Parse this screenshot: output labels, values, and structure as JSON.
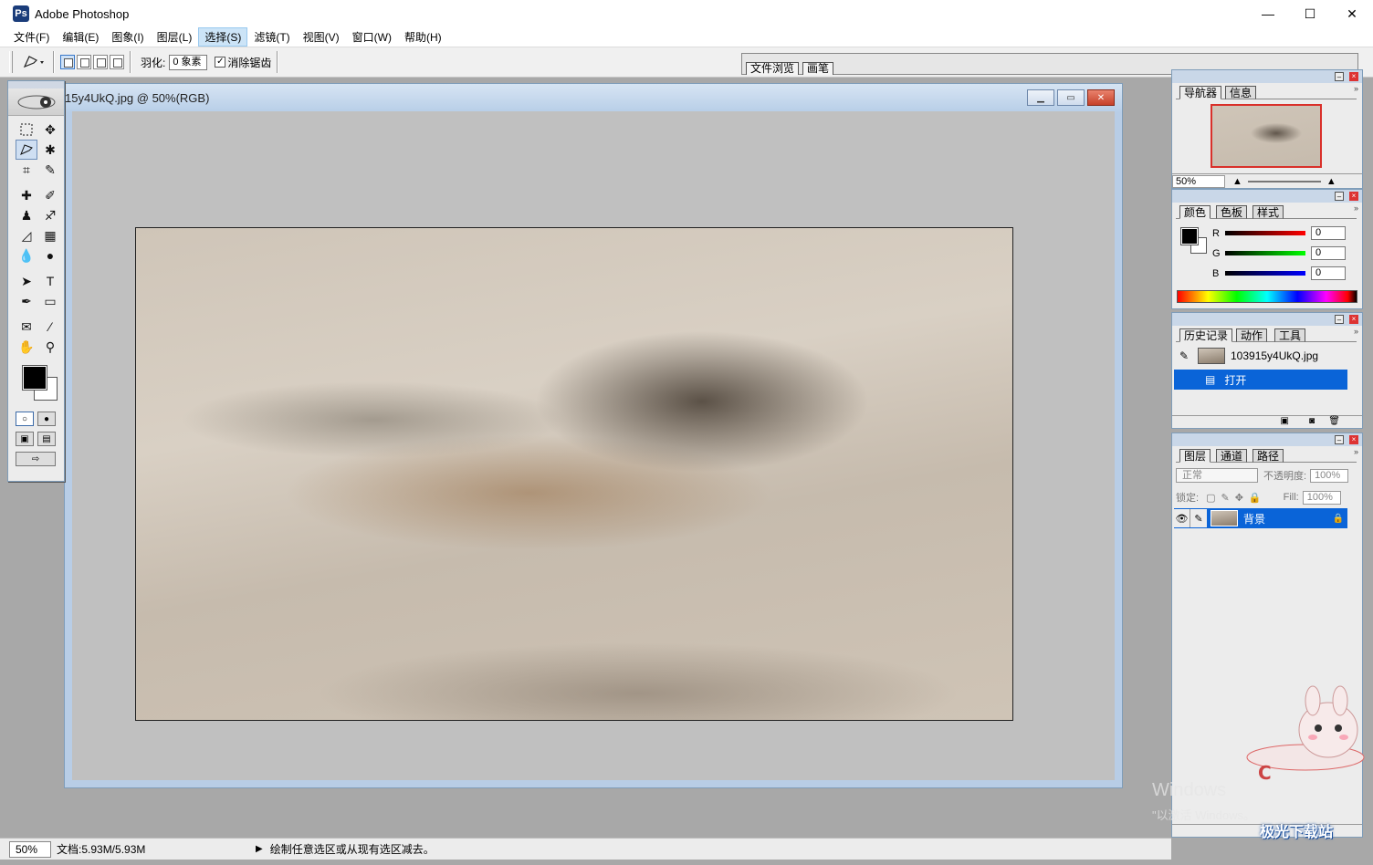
{
  "window": {
    "title": "Adobe Photoshop",
    "controls": [
      "—",
      "☐",
      "✕"
    ]
  },
  "menu": [
    "文件(F)",
    "编辑(E)",
    "图象(I)",
    "图层(L)",
    "选择(S)",
    "滤镜(T)",
    "视图(V)",
    "窗口(W)",
    "帮助(H)"
  ],
  "menu_active_index": 4,
  "options": {
    "feather_label": "羽化:",
    "feather_value": "0 象素",
    "antialias_label": "消除锯齿",
    "antialias_checked": true,
    "well_tabs": [
      "文件浏览",
      "画笔"
    ]
  },
  "document": {
    "title": "15y4UkQ.jpg @ 50%(RGB)"
  },
  "navigator": {
    "tabs": [
      "导航器",
      "信息"
    ],
    "zoom": "50%"
  },
  "color_panel": {
    "tabs": [
      "颜色",
      "色板",
      "样式"
    ],
    "channels": [
      {
        "label": "R",
        "value": "0"
      },
      {
        "label": "G",
        "value": "0"
      },
      {
        "label": "B",
        "value": "0"
      }
    ]
  },
  "history": {
    "tabs": [
      "历史记录",
      "动作",
      "工具"
    ],
    "snapshot": "103915y4UkQ.jpg",
    "steps": [
      "打开"
    ]
  },
  "layers": {
    "tabs": [
      "图层",
      "通道",
      "路径"
    ],
    "blend_mode": "正常",
    "opacity_label": "不透明度:",
    "opacity_value": "100%",
    "lock_label": "锁定:",
    "fill_label": "Fill:",
    "fill_value": "100%",
    "layer_name": "背景"
  },
  "status": {
    "zoom": "50%",
    "doc_info": "文档:5.93M/5.93M",
    "hint": "绘制任意选区或从现有选区减去。"
  },
  "watermark": {
    "line1": "Windows",
    "line2": "\"以激活 Windows。",
    "brand": "极光下载站"
  }
}
